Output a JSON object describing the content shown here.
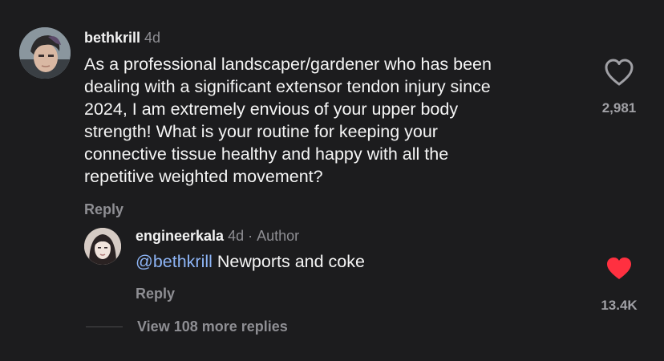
{
  "comment": {
    "username": "bethkrill",
    "time": "4d",
    "text": "As a professional landscaper/gardener who has been dealing with a significant extensor tendon injury since 2024, I am extremely envious of your upper body strength! What is your routine for keeping your connective tissue healthy and happy with all the repetitive weighted movement?",
    "lines": [
      "As a professional landscaper/gardener who has been",
      "dealing with a significant extensor tendon injury since",
      "2024, I am extremely envious of your upper body",
      "strength! What is your routine for keeping your",
      "connective tissue healthy and happy with all the",
      "repetitive weighted movement?"
    ],
    "reply_label": "Reply",
    "like_count": "2,981",
    "liked": false,
    "like_icon": "heart-outline-icon"
  },
  "reply": {
    "username": "engineerkala",
    "time": "4d",
    "separator": "·",
    "author_badge": "Author",
    "mention": "@bethkrill",
    "text": "Newports and coke",
    "reply_label": "Reply",
    "like_count": "13.4K",
    "liked": true,
    "like_icon": "heart-filled-icon",
    "like_color": "#ff3040"
  },
  "more_replies": {
    "label": "View 108 more replies"
  }
}
